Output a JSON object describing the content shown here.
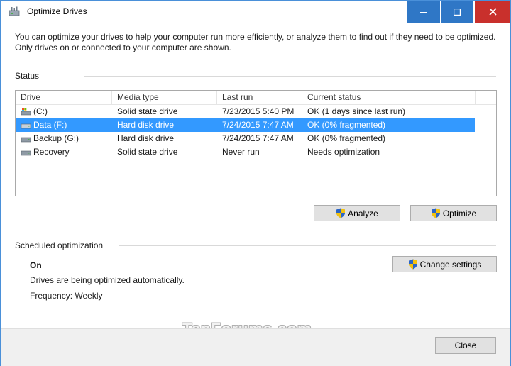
{
  "window": {
    "title": "Optimize Drives",
    "minimize_icon": "minimize-icon",
    "maximize_icon": "maximize-icon",
    "close_icon": "close-icon",
    "titlebar_button_color": "#2f77c6",
    "close_button_color": "#c9302c"
  },
  "intro_text": "You can optimize your drives to help your computer run more efficiently, or analyze them to find out if they need to be optimized. Only drives on or connected to your computer are shown.",
  "status": {
    "label": "Status",
    "columns": [
      "Drive",
      "Media type",
      "Last run",
      "Current status"
    ],
    "rows": [
      {
        "drive": "(C:)",
        "media": "Solid state drive",
        "last_run": "7/23/2015 5:40 PM",
        "status": "OK (1 days since last run)",
        "icon": "system-drive-icon",
        "selected": false
      },
      {
        "drive": "Data (F:)",
        "media": "Hard disk drive",
        "last_run": "7/24/2015 7:47 AM",
        "status": "OK (0% fragmented)",
        "icon": "drive-icon",
        "selected": true
      },
      {
        "drive": "Backup (G:)",
        "media": "Hard disk drive",
        "last_run": "7/24/2015 7:47 AM",
        "status": "OK (0% fragmented)",
        "icon": "drive-icon",
        "selected": false
      },
      {
        "drive": "Recovery",
        "media": "Solid state drive",
        "last_run": "Never run",
        "status": "Needs optimization",
        "icon": "drive-icon",
        "selected": false
      }
    ],
    "selection_color": "#3399ff",
    "analyze_label": "Analyze",
    "optimize_label": "Optimize"
  },
  "scheduled": {
    "label": "Scheduled optimization",
    "state": "On",
    "description": "Drives are being optimized automatically.",
    "frequency": "Frequency: Weekly",
    "change_settings_label": "Change settings"
  },
  "watermark": "TenForums.com",
  "footer": {
    "close_label": "Close"
  }
}
